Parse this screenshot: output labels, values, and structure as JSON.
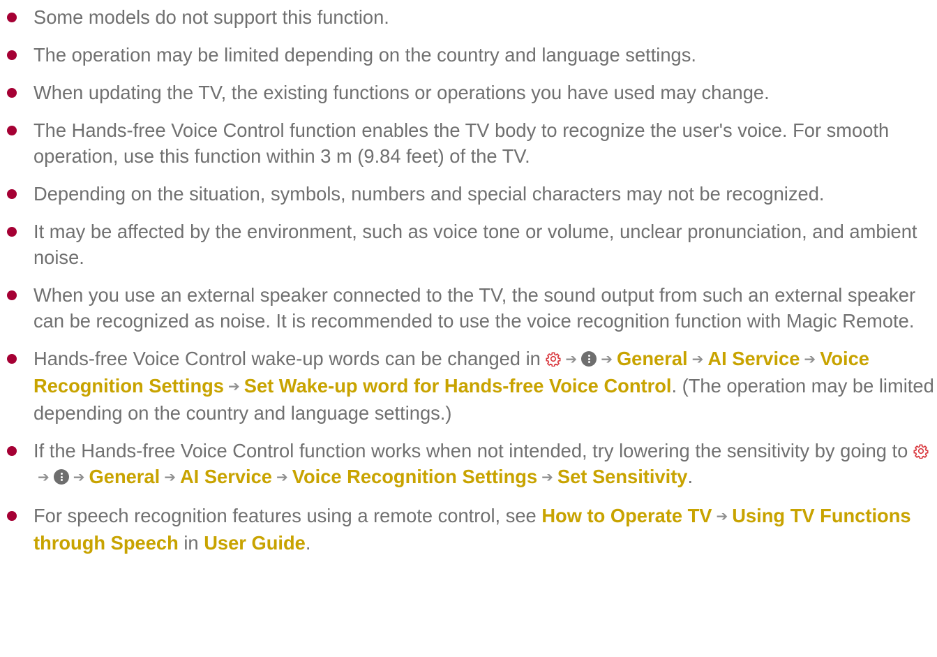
{
  "colors": {
    "bullet": "#a50034",
    "highlight": "#c8a300",
    "text": "#707070"
  },
  "icons": {
    "settings": "gear-icon",
    "all_settings": "more-icon",
    "path_separator": "arrow-right-icon"
  },
  "notes": {
    "n1": {
      "text": "Some models do not support this function."
    },
    "n2": {
      "text": "The operation may be limited depending on the country and language settings."
    },
    "n3": {
      "text": "When updating the TV, the existing functions or operations you have used may change."
    },
    "n4": {
      "text": "The Hands-free Voice Control function enables the TV body to recognize the user's voice. For smooth operation, use this function within 3 m (9.84 feet) of the TV."
    },
    "n5": {
      "text": "Depending on the situation, symbols, numbers and special characters may not be recognized."
    },
    "n6": {
      "text": "It may be affected by the environment, such as voice tone or volume, unclear pronunciation, and ambient noise."
    },
    "n7": {
      "text": "When you use an external speaker connected to the TV, the sound output from such an external speaker can be recognized as noise. It is recommended to use the voice recognition function with Magic Remote."
    },
    "n8": {
      "intro": "Hands-free Voice Control wake-up words can be changed in",
      "path": [
        "General",
        "AI Service",
        "Voice Recognition Settings",
        "Set Wake-up word for Hands-free Voice Control"
      ],
      "outro": ". (The operation may be limited depending on the country and language settings.)"
    },
    "n9": {
      "intro": "If the Hands-free Voice Control function works when not intended, try lowering the sensitivity by going to",
      "path": [
        "General",
        "AI Service",
        "Voice Recognition Settings",
        "Set Sensitivity"
      ],
      "outro": "."
    },
    "n10": {
      "intro": "For speech recognition features using a remote control, see",
      "path": [
        "How to Operate TV",
        "Using TV Functions through Speech"
      ],
      "mid": "in",
      "guide": "User Guide",
      "outro": "."
    }
  }
}
